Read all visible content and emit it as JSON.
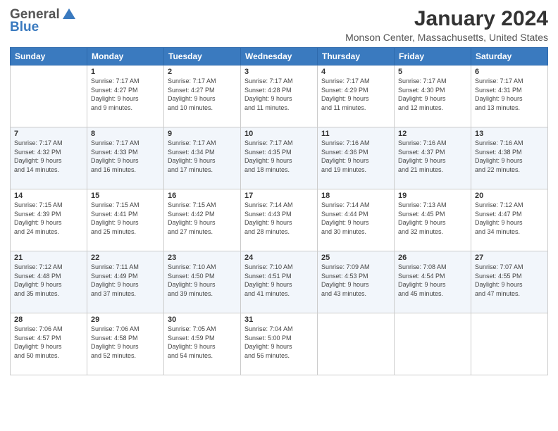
{
  "header": {
    "logo_general": "General",
    "logo_blue": "Blue",
    "month_year": "January 2024",
    "location": "Monson Center, Massachusetts, United States"
  },
  "days_of_week": [
    "Sunday",
    "Monday",
    "Tuesday",
    "Wednesday",
    "Thursday",
    "Friday",
    "Saturday"
  ],
  "weeks": [
    [
      {
        "day": "",
        "info": ""
      },
      {
        "day": "1",
        "info": "Sunrise: 7:17 AM\nSunset: 4:27 PM\nDaylight: 9 hours\nand 9 minutes."
      },
      {
        "day": "2",
        "info": "Sunrise: 7:17 AM\nSunset: 4:27 PM\nDaylight: 9 hours\nand 10 minutes."
      },
      {
        "day": "3",
        "info": "Sunrise: 7:17 AM\nSunset: 4:28 PM\nDaylight: 9 hours\nand 11 minutes."
      },
      {
        "day": "4",
        "info": "Sunrise: 7:17 AM\nSunset: 4:29 PM\nDaylight: 9 hours\nand 11 minutes."
      },
      {
        "day": "5",
        "info": "Sunrise: 7:17 AM\nSunset: 4:30 PM\nDaylight: 9 hours\nand 12 minutes."
      },
      {
        "day": "6",
        "info": "Sunrise: 7:17 AM\nSunset: 4:31 PM\nDaylight: 9 hours\nand 13 minutes."
      }
    ],
    [
      {
        "day": "7",
        "info": "Sunrise: 7:17 AM\nSunset: 4:32 PM\nDaylight: 9 hours\nand 14 minutes."
      },
      {
        "day": "8",
        "info": "Sunrise: 7:17 AM\nSunset: 4:33 PM\nDaylight: 9 hours\nand 16 minutes."
      },
      {
        "day": "9",
        "info": "Sunrise: 7:17 AM\nSunset: 4:34 PM\nDaylight: 9 hours\nand 17 minutes."
      },
      {
        "day": "10",
        "info": "Sunrise: 7:17 AM\nSunset: 4:35 PM\nDaylight: 9 hours\nand 18 minutes."
      },
      {
        "day": "11",
        "info": "Sunrise: 7:16 AM\nSunset: 4:36 PM\nDaylight: 9 hours\nand 19 minutes."
      },
      {
        "day": "12",
        "info": "Sunrise: 7:16 AM\nSunset: 4:37 PM\nDaylight: 9 hours\nand 21 minutes."
      },
      {
        "day": "13",
        "info": "Sunrise: 7:16 AM\nSunset: 4:38 PM\nDaylight: 9 hours\nand 22 minutes."
      }
    ],
    [
      {
        "day": "14",
        "info": "Sunrise: 7:15 AM\nSunset: 4:39 PM\nDaylight: 9 hours\nand 24 minutes."
      },
      {
        "day": "15",
        "info": "Sunrise: 7:15 AM\nSunset: 4:41 PM\nDaylight: 9 hours\nand 25 minutes."
      },
      {
        "day": "16",
        "info": "Sunrise: 7:15 AM\nSunset: 4:42 PM\nDaylight: 9 hours\nand 27 minutes."
      },
      {
        "day": "17",
        "info": "Sunrise: 7:14 AM\nSunset: 4:43 PM\nDaylight: 9 hours\nand 28 minutes."
      },
      {
        "day": "18",
        "info": "Sunrise: 7:14 AM\nSunset: 4:44 PM\nDaylight: 9 hours\nand 30 minutes."
      },
      {
        "day": "19",
        "info": "Sunrise: 7:13 AM\nSunset: 4:45 PM\nDaylight: 9 hours\nand 32 minutes."
      },
      {
        "day": "20",
        "info": "Sunrise: 7:12 AM\nSunset: 4:47 PM\nDaylight: 9 hours\nand 34 minutes."
      }
    ],
    [
      {
        "day": "21",
        "info": "Sunrise: 7:12 AM\nSunset: 4:48 PM\nDaylight: 9 hours\nand 35 minutes."
      },
      {
        "day": "22",
        "info": "Sunrise: 7:11 AM\nSunset: 4:49 PM\nDaylight: 9 hours\nand 37 minutes."
      },
      {
        "day": "23",
        "info": "Sunrise: 7:10 AM\nSunset: 4:50 PM\nDaylight: 9 hours\nand 39 minutes."
      },
      {
        "day": "24",
        "info": "Sunrise: 7:10 AM\nSunset: 4:51 PM\nDaylight: 9 hours\nand 41 minutes."
      },
      {
        "day": "25",
        "info": "Sunrise: 7:09 AM\nSunset: 4:53 PM\nDaylight: 9 hours\nand 43 minutes."
      },
      {
        "day": "26",
        "info": "Sunrise: 7:08 AM\nSunset: 4:54 PM\nDaylight: 9 hours\nand 45 minutes."
      },
      {
        "day": "27",
        "info": "Sunrise: 7:07 AM\nSunset: 4:55 PM\nDaylight: 9 hours\nand 47 minutes."
      }
    ],
    [
      {
        "day": "28",
        "info": "Sunrise: 7:06 AM\nSunset: 4:57 PM\nDaylight: 9 hours\nand 50 minutes."
      },
      {
        "day": "29",
        "info": "Sunrise: 7:06 AM\nSunset: 4:58 PM\nDaylight: 9 hours\nand 52 minutes."
      },
      {
        "day": "30",
        "info": "Sunrise: 7:05 AM\nSunset: 4:59 PM\nDaylight: 9 hours\nand 54 minutes."
      },
      {
        "day": "31",
        "info": "Sunrise: 7:04 AM\nSunset: 5:00 PM\nDaylight: 9 hours\nand 56 minutes."
      },
      {
        "day": "",
        "info": ""
      },
      {
        "day": "",
        "info": ""
      },
      {
        "day": "",
        "info": ""
      }
    ]
  ]
}
